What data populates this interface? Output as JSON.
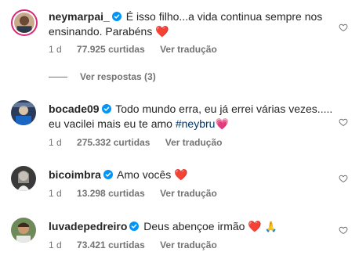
{
  "colors": {
    "verified": "#0095f6",
    "heart": "#e0245e",
    "meta_text": "#737373",
    "hashtag": "#00376b"
  },
  "icons": {
    "verified": "verified-badge-icon",
    "like": "heart-outline-icon"
  },
  "comments": [
    {
      "username": "neymarpai_",
      "text": "É isso filho...a vida continua sempre nos ensinando. Parabéns",
      "emoji": "❤️",
      "time": "1 d",
      "likes": "77.925 curtidas",
      "translate": "Ver tradução",
      "view_replies": "Ver respostas (3)"
    },
    {
      "username": "bocade09",
      "text": "Todo mundo erra, eu já errei várias vezes..... eu vacilei mais eu te amo",
      "hashtag": "#neybru",
      "emoji": "💗",
      "time": "1 d",
      "likes": "275.332 curtidas",
      "translate": "Ver tradução"
    },
    {
      "username": "bicoimbra",
      "text": "Amo vocês",
      "emoji": "❤️",
      "time": "1 d",
      "likes": "13.298 curtidas",
      "translate": "Ver tradução"
    },
    {
      "username": "luvadepedreiro",
      "text": "Deus abençoe irmão",
      "emoji": "❤️",
      "emoji2": "🙏",
      "time": "1 d",
      "likes": "73.421 curtidas",
      "translate": "Ver tradução"
    }
  ]
}
